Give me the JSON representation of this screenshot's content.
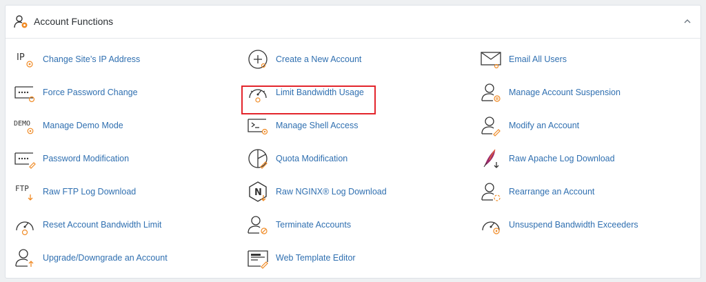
{
  "header": {
    "title": "Account Functions",
    "icon": "account-gear-icon",
    "chevron_icon": "chevron-up-icon"
  },
  "accent_colors": {
    "link": "#2f6fb0",
    "icon_accent": "#f08a24",
    "highlight_border": "#e3232a"
  },
  "columns": [
    [
      {
        "label": "Change Site’s IP Address",
        "icon": "ip-icon",
        "icon_text": "IP"
      },
      {
        "label": "Force Password Change",
        "icon": "password-field-icon"
      },
      {
        "label": "Manage Demo Mode",
        "icon": "demo-icon",
        "icon_text": "DEMO"
      },
      {
        "label": "Password Modification",
        "icon": "password-edit-icon"
      },
      {
        "label": "Raw FTP Log Download",
        "icon": "ftp-download-icon",
        "icon_text": "FTP"
      },
      {
        "label": "Reset Account Bandwidth Limit",
        "icon": "bandwidth-reset-icon"
      },
      {
        "label": "Upgrade/Downgrade an Account",
        "icon": "user-upgrade-icon"
      }
    ],
    [
      {
        "label": "Create a New Account",
        "icon": "plus-circle-icon"
      },
      {
        "label": "Limit Bandwidth Usage",
        "icon": "speedometer-icon",
        "highlighted": true
      },
      {
        "label": "Manage Shell Access",
        "icon": "terminal-icon"
      },
      {
        "label": "Quota Modification",
        "icon": "pie-chart-icon"
      },
      {
        "label": "Raw NGINX® Log Download",
        "icon": "nginx-icon",
        "icon_text": "N"
      },
      {
        "label": "Terminate Accounts",
        "icon": "user-terminate-icon"
      },
      {
        "label": "Web Template Editor",
        "icon": "web-template-icon"
      }
    ],
    [
      {
        "label": "Email All Users",
        "icon": "envelope-user-icon"
      },
      {
        "label": "Manage Account Suspension",
        "icon": "user-pause-icon"
      },
      {
        "label": "Modify an Account",
        "icon": "user-edit-icon"
      },
      {
        "label": "Raw Apache Log Download",
        "icon": "apache-feather-icon"
      },
      {
        "label": "Rearrange an Account",
        "icon": "user-rearrange-icon"
      },
      {
        "label": "Unsuspend Bandwidth Exceeders",
        "icon": "bandwidth-play-icon"
      }
    ]
  ]
}
